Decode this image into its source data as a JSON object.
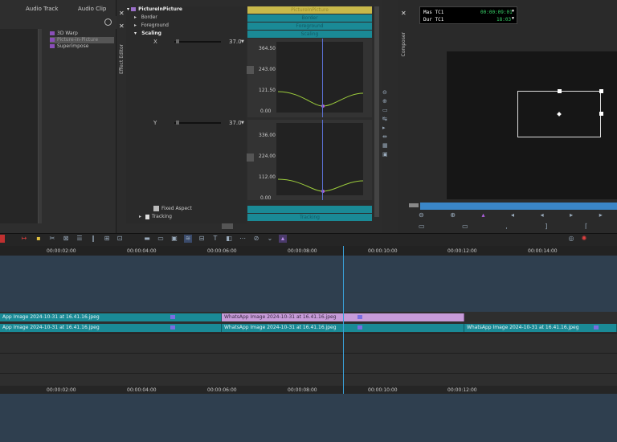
{
  "bin": {
    "tabs": [
      "Audio Track",
      "Audio Clip"
    ],
    "items": [
      "3D Warp",
      "Picture-in-Picture",
      "Superimpose"
    ]
  },
  "effect_editor": {
    "vtab": "Effect Editor",
    "root": "PictureInPicture",
    "params": [
      "Border",
      "Foreground",
      "Scaling"
    ],
    "x_label": "X",
    "x_value": "37.0",
    "y_label": "Y",
    "y_value": "37.0",
    "fixed_aspect": "Fixed Aspect",
    "tracking": "Tracking",
    "graph1_ticks": [
      "364.50",
      "243.00",
      "121.50",
      "0.00"
    ],
    "graph2_ticks": [
      "336.00",
      "224.00",
      "112.00",
      "0.00"
    ],
    "bar_labels": [
      "PictureInPicture",
      "Border",
      "Foreground",
      "Scaling",
      "Tracking"
    ]
  },
  "composer": {
    "vtab": "Composer",
    "mas_label": "Mas",
    "mas_tc": "TC1",
    "mas_value": "00:00:09:01",
    "dur_label": "Dur",
    "dur_tc": "TC1",
    "dur_value": "18:03"
  },
  "timeline": {
    "ruler": [
      "00:00:02:00",
      "00:00:04:00",
      "00:00:06:00",
      "00:00:08:00",
      "00:00:10:00",
      "00:00:12:00",
      "00:00:14:00"
    ],
    "ruler2": [
      "00:00:02:00",
      "00:00:04:00",
      "00:00:06:00",
      "00:00:08:00",
      "00:00:10:00",
      "00:00:12:00"
    ],
    "clip_name": "WhatsApp Image 2024-10-31 at 16.41.16.jpeg",
    "clip_name_cut": "App Image 2024-10-31 at 16.41.16.jpeg"
  },
  "colors": {
    "teal": "#1a8a96",
    "purple": "#c79bd9",
    "playhead": "#3aa0d8",
    "curve": "#9ccc3c"
  }
}
